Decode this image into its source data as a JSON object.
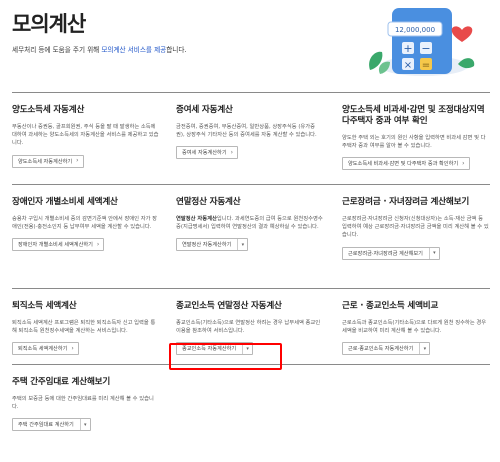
{
  "header": {
    "title": "모의계산",
    "desc_prefix": "세무처리 등에 도움을 주기 위해 ",
    "desc_highlight": "모의계산 서비스를 제공",
    "desc_suffix": "합니다.",
    "illustration_number": "12,000,000"
  },
  "sections": [
    {
      "title": "양도소득세 자동계산",
      "desc": "부동산이나 증권등, 골프회원권, 주식 등을 팔 때 발생하는 소득에 대하여 과세하는 양도소득세의 자동계산을 서비스를 제공하고 있습니다.",
      "button": "양도소득세 자동계산하기"
    },
    {
      "title": "증여세 자동계산",
      "desc": "금전증여, 증권증여, 부동산증여, 일반상품, 상장주식등 (유가증권), 상장주식 기타자산 등의 증여세를 자동 계산할 수 있습니다.",
      "button": "증여세 자동계산하기"
    },
    {
      "title": "양도소득세 비과세·감면 및 조정대상지역 다주택자 중과 여부 확인",
      "desc": "양도한 주택 외는 호기의 원인 사항을 입력하면 비과세 감면 및 다주택자 중과 여부를 알아 볼 수 있습니다.",
      "button": "양도소득세 비과세·감면 및 다주택자 중과 확인하기"
    },
    {
      "title": "장애인자 개별소비세 세액계산",
      "desc": "승용차 구입시 개별소비세 중의 감면기준액 안에서 장애인 자가 장애인(전용)·충전소인지 등 납부여부 세액을 계산할 수 있습니다.",
      "button": "장애인자 개별소비세 세액계산하기"
    },
    {
      "title": "연말정산 자동계산",
      "desc_bold": "연말정산 자동계산",
      "desc": "입니다. 과세연도중의 급여 등으로 원천징수영수증(지급명세서) 입력하여 연말정산의 결과 예상하실 수 있습니다.",
      "button": "연말정산 자동계산하기"
    },
    {
      "title": "근로장려금 · 자녀장려금 계산해보기",
      "desc": "근로장려금·자녀장려금 신청자(신청대상자)는 소득·재산 금액 등 입력하여 예상 근로장려금·자녀장려금 금액을 미리 계산해 볼 수 있습니다.",
      "button": "근로장려금·자녀장려금 계산해보기"
    },
    {
      "title": "퇴직소득 세액계산",
      "desc": "퇴직소득 세액계산 프로그램은 퇴직한 퇴직소득자 신고 입력을 통해 퇴직소득 원천징수세액을 계산하는 서비스입니다.",
      "button": "퇴직소득 세액계산하기"
    },
    {
      "title": "종교인소득 연말정산 자동계산",
      "desc": "종교인소득(기타소득)으로 연말정산 하려는 경우 납부세액 종교인이용을 참조하여 서비스입니다.",
      "button": "종교인소득 자동계산하기"
    },
    {
      "title": "근로 · 종교인소득 세액비교",
      "desc": "근로소득과 종교인소득(기타소득)으로 다르게 원천 징수하는 경우 세액을 비교하여 미리 계산해 볼 수 있습니다.",
      "button": "근로·종교인소득 자동계산하기"
    },
    {
      "title": "주택 간주임대료 계산해보기",
      "desc": "주택의 보증금 등에 대한 간주임대료를 미리 계산해 볼 수 있습니다.",
      "button": "주택 간주임대료 계산하기"
    }
  ],
  "colors": {
    "accent_blue": "#1f55c8",
    "highlight_red": "#ff0000",
    "calculator_blue": "#4a8fe0",
    "leaf_green": "#3aa86b",
    "heart_red": "#e84a4a"
  }
}
